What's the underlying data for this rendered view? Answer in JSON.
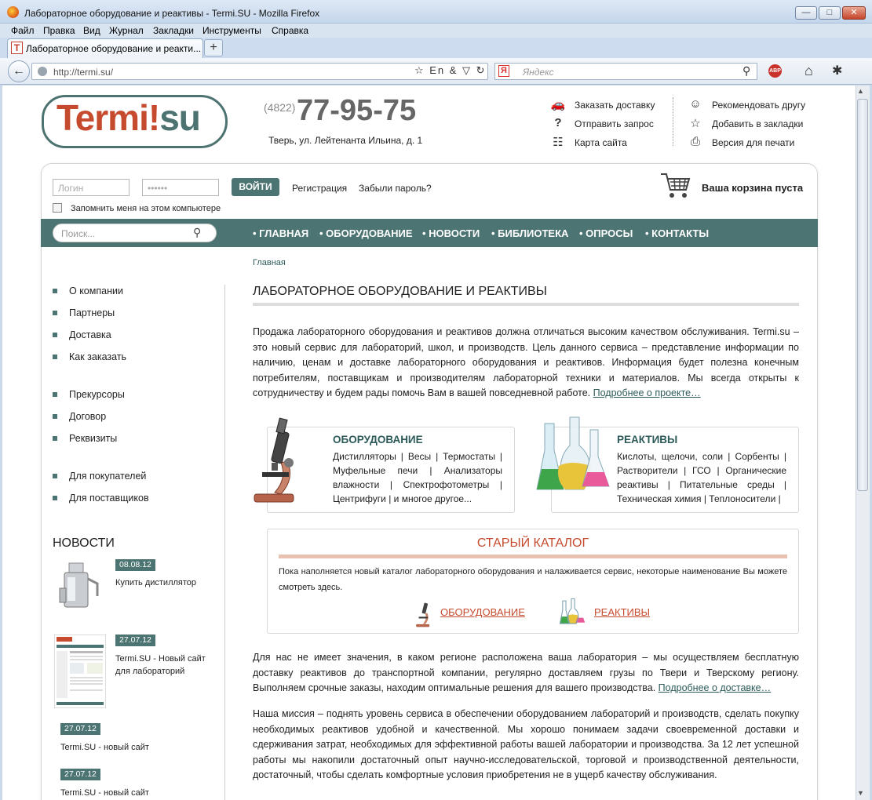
{
  "browser": {
    "window_title": "Лабораторное оборудование и реактивы - Termi.SU - Mozilla Firefox",
    "menu": [
      "Файл",
      "Правка",
      "Вид",
      "Журнал",
      "Закладки",
      "Инструменты",
      "Справка"
    ],
    "tab_title": "Лабораторное оборудование и реакти...",
    "tab_favicon": "T",
    "url": "http://termi.su/",
    "search_placeholder": "Яндекс",
    "url_icons": "☆ En & ▽ ↻",
    "abp_label": "ABP"
  },
  "header": {
    "logo_main": "Termi",
    "logo_excl": "!",
    "logo_su": "su",
    "phone_code": "(4822)",
    "phone": "77-95-75",
    "address": "Тверь, ул. Лейтенанта Ильина, д. 1",
    "links_left": [
      "Заказать доставку",
      "Отправить запрос",
      "Карта сайта"
    ],
    "links_right": [
      "Рекомендовать другу",
      "Добавить в закладки",
      "Версия для печати"
    ]
  },
  "login": {
    "login_placeholder": "Логин",
    "password_value": "••••••",
    "submit_label": "ВОЙТИ",
    "register_label": "Регистрация",
    "forgot_label": "Забыли пароль?",
    "remember_label": "Запомнить меня на этом компьютере"
  },
  "cart": {
    "label": "Ваша корзина пуста"
  },
  "search": {
    "placeholder": "Поиск..."
  },
  "nav": [
    "ГЛАВНАЯ",
    "ОБОРУДОВАНИЕ",
    "НОВОСТИ",
    "БИБЛИОТЕКА",
    "ОПРОСЫ",
    "КОНТАКТЫ"
  ],
  "breadcrumb": "Главная",
  "sidebar": {
    "group1": [
      "О компании",
      "Партнеры",
      "Доставка",
      "Как заказать"
    ],
    "group2": [
      "Прекурсоры",
      "Договор",
      "Реквизиты"
    ],
    "group3": [
      "Для покупателей",
      "Для поставщиков"
    ]
  },
  "news": {
    "heading": "НОВОСТИ",
    "items": [
      {
        "date": "08.08.12",
        "text": "Купить дистиллятор"
      },
      {
        "date": "27.07.12",
        "text": "Termi.SU - Новый сайт для лабораторий"
      },
      {
        "date": "27.07.12",
        "text": "Termi.SU - новый сайт"
      },
      {
        "date": "27.07.12",
        "text": "Termi.SU - новый сайт"
      }
    ]
  },
  "main": {
    "title": "ЛАБОРАТОРНОЕ ОБОРУДОВАНИЕ И РЕАКТИВЫ",
    "intro": "Продажа лабораторного оборудования и реактивов должна отличаться высоким качеством обслуживания. Termi.su – это новый сервис для лабораторий, школ, и производств. Цель данного сервиса – представление информации по наличию, ценам и доставке лабораторного оборудования и реактивов. Информация будет полезна конечным потребителям, поставщикам и производителям лабораторной техники и материалов. Мы всегда открыты к сотрудничеству и будем рады помочь Вам в вашей повседневной работе.",
    "intro_link": "Подробнее о проекте…",
    "equipment": {
      "title": "ОБОРУДОВАНИЕ",
      "text": "Дистилляторы | Весы | Термостаты | Муфельные печи | Анализаторы влажности | Спектрофотометры | Центрифуги | и многое другое..."
    },
    "reagents": {
      "title": "РЕАКТИВЫ",
      "text": "Кислоты, щелочи, соли | Сорбенты | Растворители | ГСО | Органические реактивы | Питательные среды | Техническая химия | Теплоносители |"
    },
    "old_catalog": {
      "title": "СТАРЫЙ КАТАЛОГ",
      "text": "Пока наполняется новый каталог лабораторного оборудования и налаживается сервис, некоторые наименование Вы можете смотреть здесь.",
      "link_equipment": "ОБОРУДОВАНИЕ",
      "link_reagents": "РЕАКТИВЫ"
    },
    "delivery": "Для нас не имеет значения, в каком регионе расположена ваша лаборатория – мы осуществляем бесплатную доставку реактивов до транспортной компании, регулярно доставляем грузы по Твери и Тверскому региону. Выполняем срочные заказы, находим оптимальные решения для вашего производства.",
    "delivery_link": "Подробнее о доставке…",
    "mission": "Наша миссия – поднять уровень сервиса в обеспечении оборудованием лабораторий и производств, сделать покупку необходимых реактивов удобной и качественной. Мы хорошо понимаем задачи своевременной доставки и сдерживания затрат, необходимых для эффективной работы вашей лаборатории и производства. За 12 лет успешной работы мы накопили достаточный опыт научно-исследовательской, торговой и производственной деятельности, достаточный, чтобы сделать комфортные условия приобретения не в ущерб качеству обслуживания."
  },
  "colors": {
    "accent": "#4c7472",
    "brand_red": "#c64b2e",
    "link": "#2c5a59"
  },
  "icons": [
    "firefox-icon",
    "back-arrow-icon",
    "globe-icon",
    "star-icon",
    "reload-icon",
    "yandex-icon",
    "magnifier-icon",
    "adblock-icon",
    "home-icon",
    "extension-icon",
    "car-icon",
    "question-icon",
    "sitemap-icon",
    "person-icon",
    "star-outline-icon",
    "printer-icon",
    "cart-icon",
    "search-icon",
    "microscope-icon",
    "flasks-icon"
  ]
}
